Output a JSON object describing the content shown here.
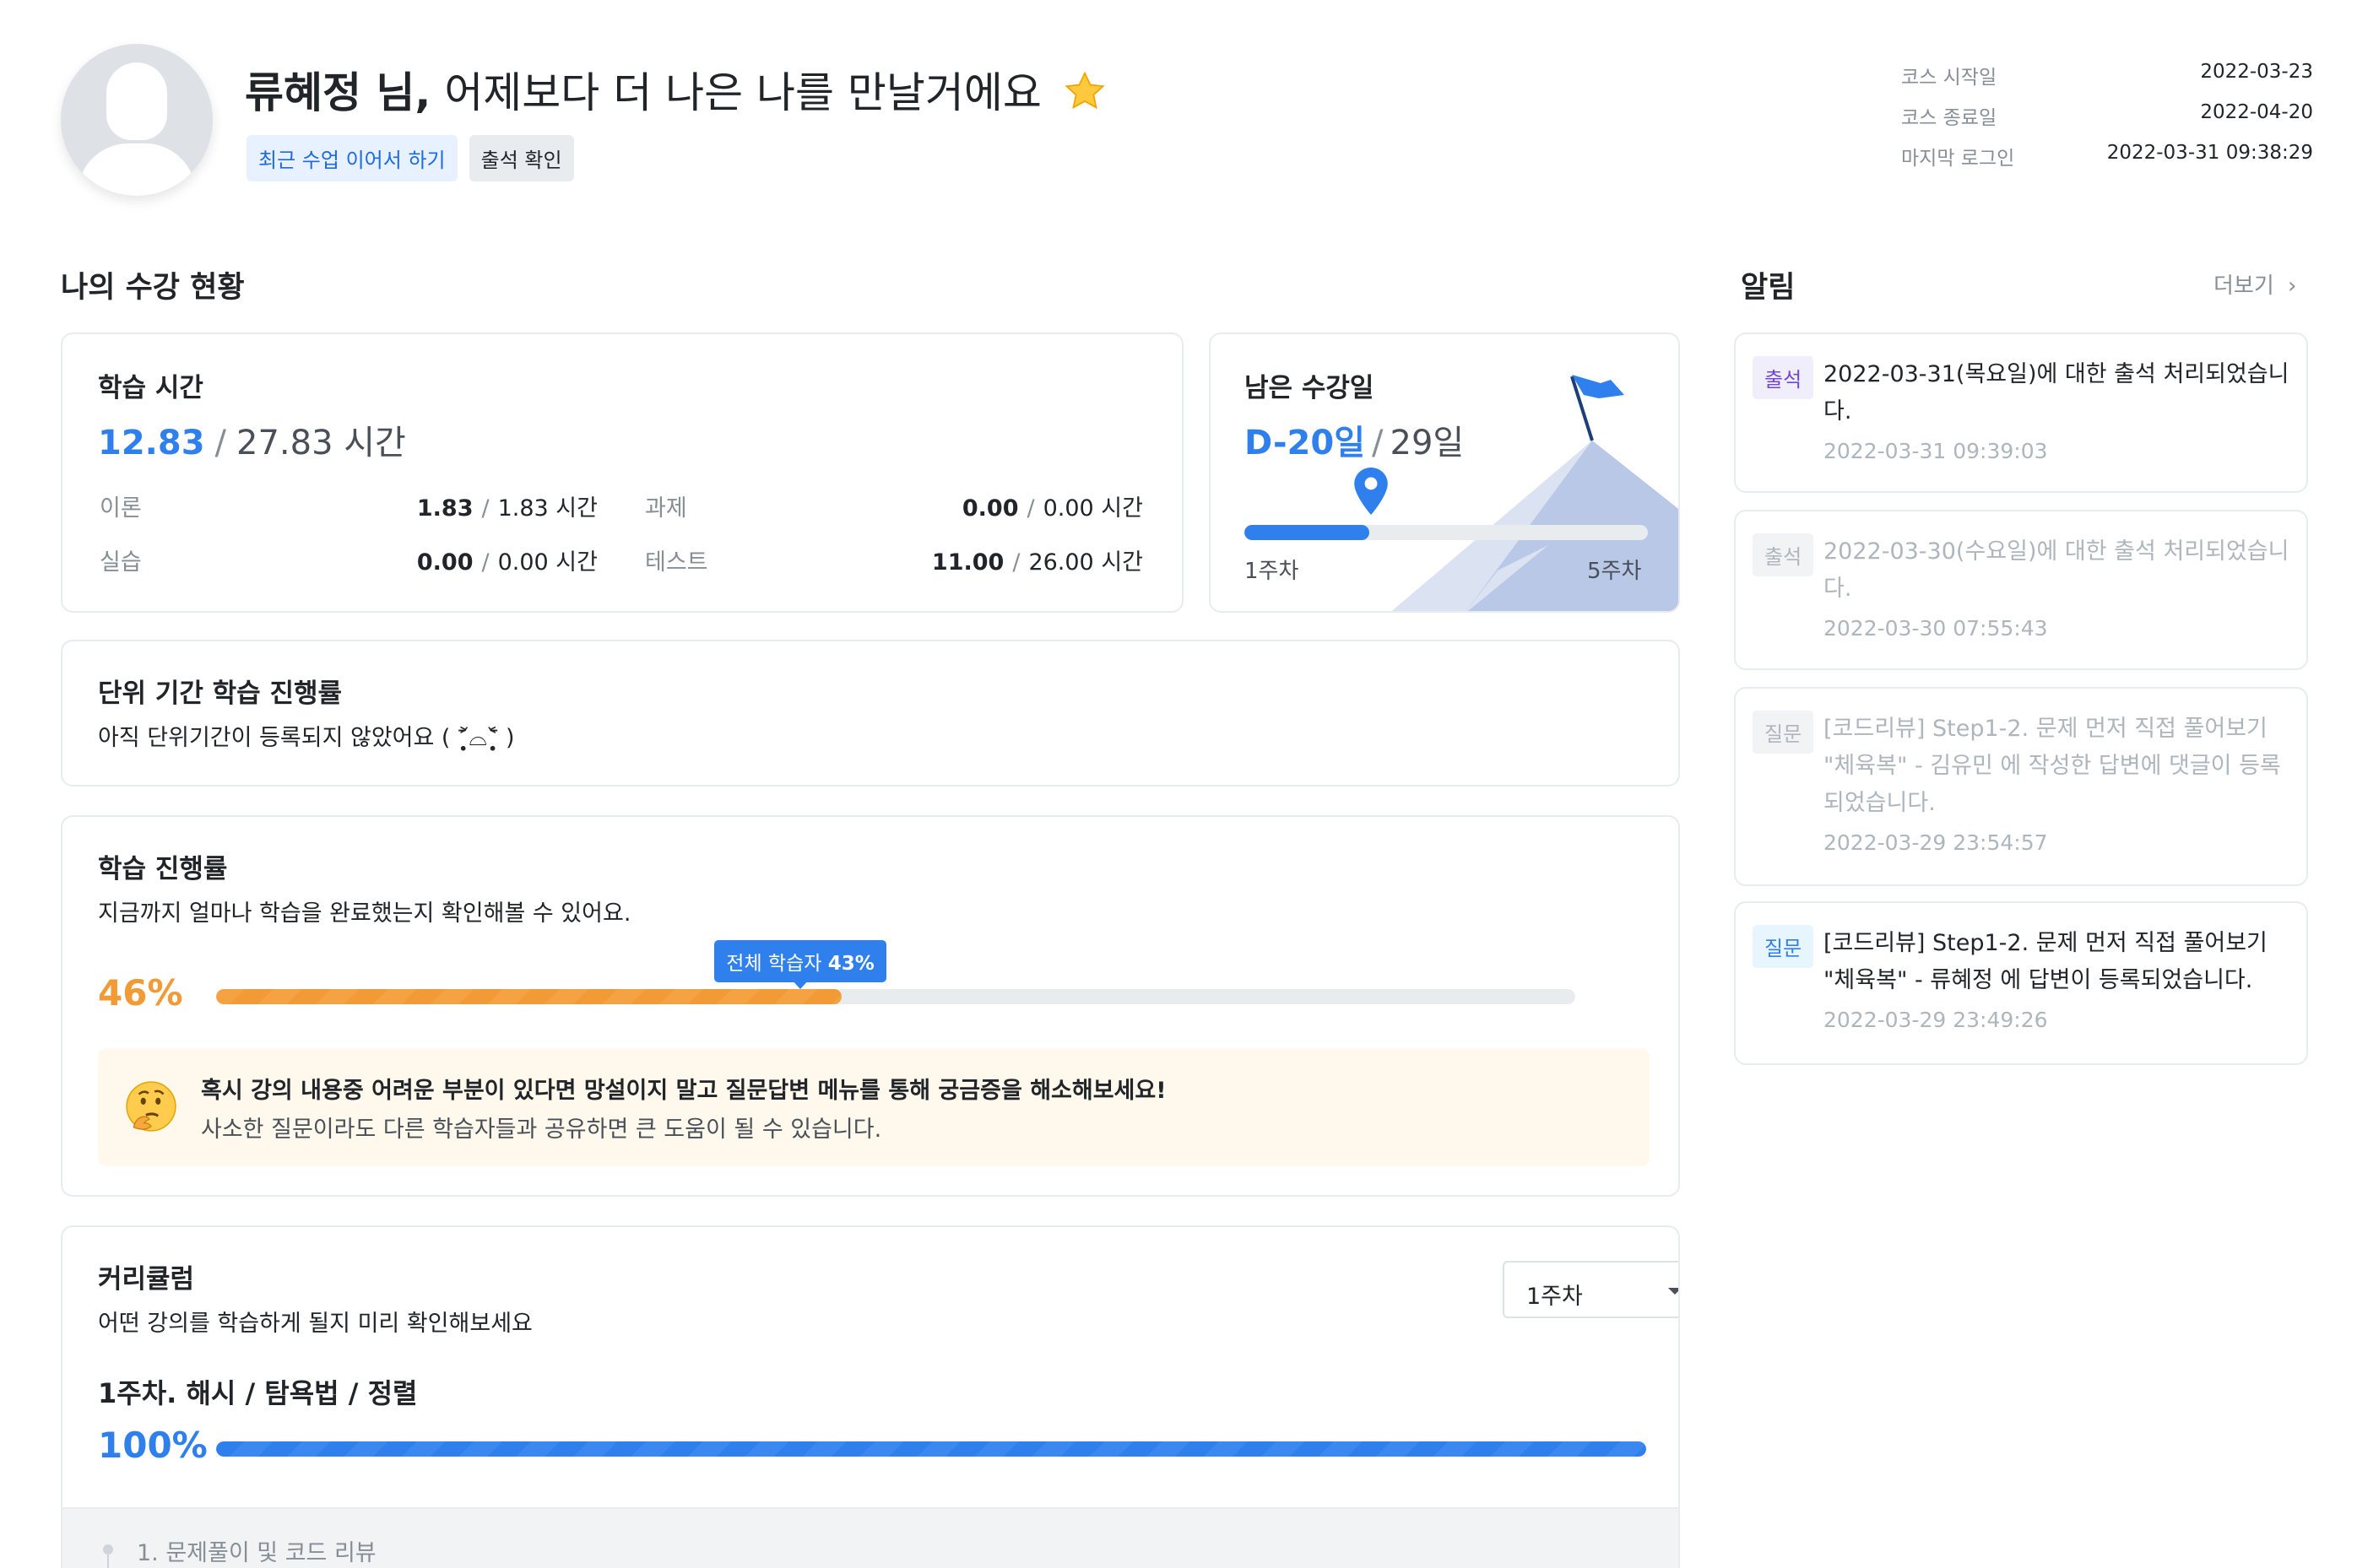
{
  "header": {
    "user_name": "류혜정 님,",
    "greeting": "어제보다 더 나은 나를 만날거에요",
    "continue_label": "최근 수업 이어서 하기",
    "attendance_label": "출석 확인",
    "meta": [
      {
        "label": "코스 시작일",
        "value": "2022-03-23"
      },
      {
        "label": "코스 종료일",
        "value": "2022-04-20"
      },
      {
        "label": "마지막 로그인",
        "value": "2022-03-31 09:38:29"
      }
    ]
  },
  "status": {
    "title": "나의 수강 현황",
    "study_time": {
      "title": "학습 시간",
      "current": "12.83",
      "separator": "/",
      "total": "27.83 시간",
      "items": [
        {
          "label": "이론",
          "done": "1.83",
          "total": "1.83 시간"
        },
        {
          "label": "과제",
          "done": "0.00",
          "total": "0.00 시간"
        },
        {
          "label": "실습",
          "done": "0.00",
          "total": "0.00 시간"
        },
        {
          "label": "테스트",
          "done": "11.00",
          "total": "26.00 시간"
        }
      ]
    },
    "remaining": {
      "title": "남은 수강일",
      "dday": "D-20일",
      "separator": "/",
      "total": "29일",
      "start_week": "1주차",
      "end_week": "5주차",
      "progress": 0.31
    },
    "unit_period": {
      "title": "단위 기간 학습 진행률",
      "message": "아직 단위기간이 등록되지 않았어요 ( ˃̣̣̥᷄⌓˂̣̣̥᷅ )"
    },
    "progress": {
      "title": "학습 진행률",
      "subtitle": "지금까지 얼마나 학습을 완료했는지 확인해볼 수 있어요.",
      "percent_label": "46%",
      "value": 0.46,
      "avg_label": "전체 학습자",
      "avg_value_label": "43%",
      "avg_value": 0.43,
      "tip_line1": "혹시 강의 내용중 어려운 부분이 있다면 망설이지 말고 질문답변 메뉴를 통해 궁금증을 해소해보세요!",
      "tip_line2": "사소한 질문이라도 다른 학습자들과 공유하면 큰 도움이 될 수 있습니다."
    },
    "curriculum": {
      "title": "커리큘럼",
      "subtitle": "어떤 강의를 학습하게 될지 미리 확인해보세요",
      "selected_week": "1주차",
      "week_title": "1주차. 해시 / 탐욕법 / 정렬",
      "percent_label": "100%",
      "value": 1.0,
      "first_lesson": "1. 문제풀이 및 코드 리뷰"
    }
  },
  "notifications": {
    "title": "알림",
    "more_label": "더보기",
    "items": [
      {
        "badge": "출석",
        "text": "2022-03-31(목요일)에 대한 출석 처리되었습니다.",
        "time": "2022-03-31 09:39:03"
      },
      {
        "badge": "출석",
        "text": "2022-03-30(수요일)에 대한 출석 처리되었습니다.",
        "time": "2022-03-30 07:55:43"
      },
      {
        "badge": "질문",
        "text": "[코드리뷰] Step1-2. 문제 먼저 직접 풀어보기 \"체육복\" - 김유민 에 작성한 답변에 댓글이 등록되었습니다.",
        "time": "2022-03-29 23:54:57"
      },
      {
        "badge": "질문",
        "text": "[코드리뷰] Step1-2. 문제 먼저 직접 풀어보기 \"체육복\" - 류혜정 에 답변이 등록되었습니다.",
        "time": "2022-03-29 23:49:26"
      }
    ]
  },
  "colors": {
    "primary": "#2f80ed",
    "orange": "#f29a35",
    "tip_bg": "#fff8ec",
    "purple_badge": "#6f47d6"
  }
}
